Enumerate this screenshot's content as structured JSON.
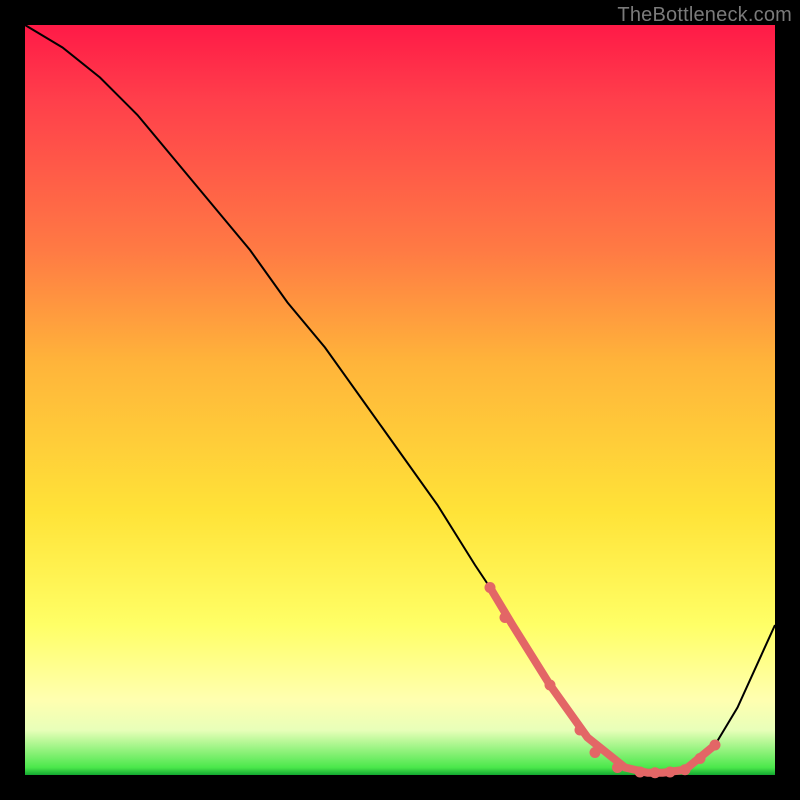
{
  "watermark": "TheBottleneck.com",
  "chart_data": {
    "type": "line",
    "title": "",
    "xlabel": "",
    "ylabel": "",
    "xlim": [
      0,
      100
    ],
    "ylim": [
      0,
      100
    ],
    "grid": false,
    "legend": false,
    "series": [
      {
        "name": "bottleneck-curve",
        "color": "#000000",
        "x": [
          0,
          5,
          10,
          15,
          20,
          25,
          30,
          35,
          40,
          45,
          50,
          55,
          60,
          62,
          65,
          70,
          75,
          80,
          83,
          85,
          88,
          92,
          95,
          100
        ],
        "y": [
          100,
          97,
          93,
          88,
          82,
          76,
          70,
          63,
          57,
          50,
          43,
          36,
          28,
          25,
          20,
          12,
          5,
          1,
          0.3,
          0.3,
          0.7,
          4,
          9,
          20
        ]
      }
    ],
    "highlight": {
      "color": "#e36666",
      "segment_x": [
        62,
        65,
        70,
        75,
        80,
        83,
        85,
        88,
        92
      ],
      "segment_y": [
        25,
        20,
        12,
        5,
        1,
        0.3,
        0.3,
        0.7,
        4
      ],
      "dots_x": [
        62,
        64,
        70,
        74,
        76,
        79,
        82,
        84,
        86,
        88,
        90,
        92
      ],
      "dots_y": [
        25,
        21,
        12,
        6,
        3,
        1,
        0.4,
        0.3,
        0.4,
        0.7,
        2.2,
        4
      ]
    }
  }
}
